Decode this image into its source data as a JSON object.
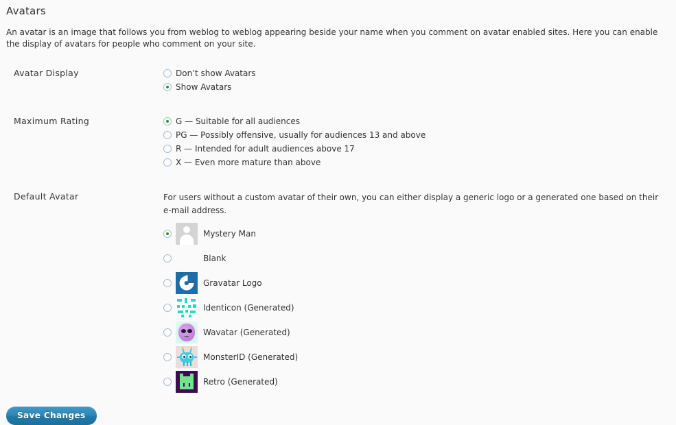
{
  "page": {
    "title": "Avatars",
    "intro": "An avatar is an image that follows you from weblog to weblog appearing beside your name when you comment on avatar enabled sites. Here you can enable the display of avatars for people who comment on your site."
  },
  "colors": {
    "background": "#fafafa",
    "text": "#333333",
    "radio_border": "#a9bccd",
    "radio_dot": "#1f9d1f",
    "button_blue": "#2e86b4",
    "gravatar_blue": "#1e6ca8",
    "identicon_teal": "#2ad6c6",
    "retro_purple": "#3e0b52",
    "retro_green": "#72e58c",
    "mystery_gray": "#d4d4d4"
  },
  "sections": {
    "avatar_display": {
      "label": "Avatar Display",
      "options": [
        {
          "label": "Don’t show Avatars",
          "checked": false
        },
        {
          "label": "Show Avatars",
          "checked": true
        }
      ]
    },
    "maximum_rating": {
      "label": "Maximum Rating",
      "options": [
        {
          "label": "G — Suitable for all audiences",
          "checked": true
        },
        {
          "label": "PG — Possibly offensive, usually for audiences 13 and above",
          "checked": false
        },
        {
          "label": "R — Intended for adult audiences above 17",
          "checked": false
        },
        {
          "label": "X — Even more mature than above",
          "checked": false
        }
      ]
    },
    "default_avatar": {
      "label": "Default Avatar",
      "helper_text": "For users without a custom avatar of their own, you can either display a generic logo or a generated one based on their e-mail address.",
      "options": [
        {
          "label": "Mystery Man",
          "icon": "mystery-man-avatar-icon",
          "checked": true
        },
        {
          "label": "Blank",
          "icon": "blank-avatar-icon",
          "checked": false
        },
        {
          "label": "Gravatar Logo",
          "icon": "gravatar-logo-icon",
          "checked": false
        },
        {
          "label": "Identicon (Generated)",
          "icon": "identicon-avatar-icon",
          "checked": false
        },
        {
          "label": "Wavatar (Generated)",
          "icon": "wavatar-avatar-icon",
          "checked": false
        },
        {
          "label": "MonsterID (Generated)",
          "icon": "monsterid-avatar-icon",
          "checked": false
        },
        {
          "label": "Retro (Generated)",
          "icon": "retro-avatar-icon",
          "checked": false
        }
      ]
    }
  },
  "submit": {
    "save_label": "Save Changes"
  }
}
